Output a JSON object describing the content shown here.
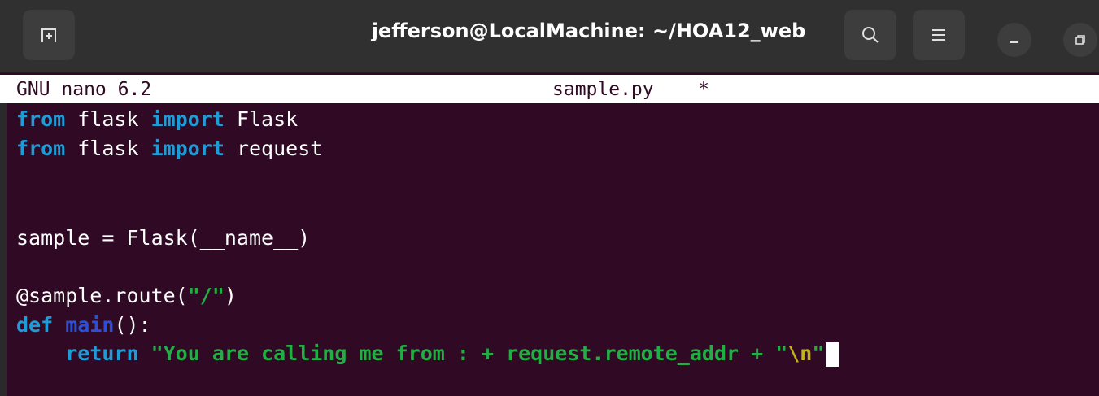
{
  "window": {
    "title": "jefferson@LocalMachine: ~/HOA12_web",
    "icons": {
      "new_tab": "new-tab-icon",
      "search": "search-icon",
      "menu": "hamburger-menu-icon",
      "minimize": "minimize-icon",
      "maximize": "maximize-icon"
    }
  },
  "nano": {
    "version": "GNU nano 6.2",
    "filename": "sample.py",
    "modified_marker": "*"
  },
  "code": {
    "line1": {
      "kw1": "from",
      "mod": " flask ",
      "kw2": "import",
      "name": " Flask"
    },
    "line2": {
      "kw1": "from",
      "mod": " flask ",
      "kw2": "import",
      "name": " request"
    },
    "line5": {
      "text": "sample = Flask(__name__)"
    },
    "line7": {
      "decorator": "@sample.route(",
      "arg": "\"/\"",
      "close": ")"
    },
    "line8": {
      "kw": "def",
      "space": " ",
      "fn": "main",
      "rest": "():"
    },
    "line9": {
      "indent": "    ",
      "kw": "return",
      "str1": " \"You are calling me from : + request.remote_addr + \"",
      "esc": "\\n",
      "str2": "\""
    }
  },
  "colors": {
    "background": "#300a24",
    "keyword": "#1f9bd6",
    "function_name": "#2a4fd8",
    "string": "#23ad45",
    "escape": "#c4b21a",
    "titlebar": "#303030"
  }
}
